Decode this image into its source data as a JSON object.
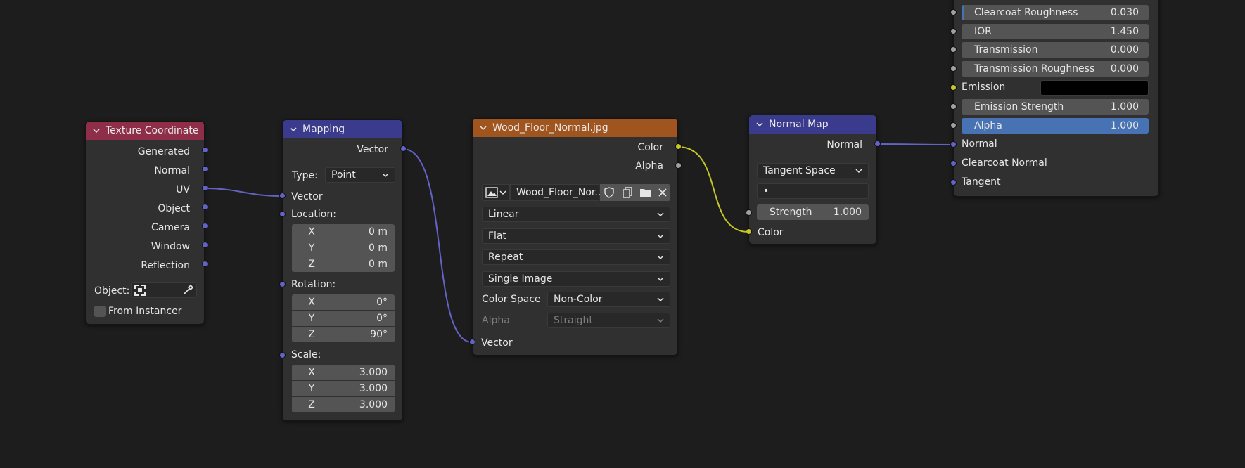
{
  "colors": {
    "background": "#1d1d1d",
    "node_body": "#303030",
    "header_texture_coordinate": "#8e2e48",
    "header_vector": "#3b3b8e",
    "header_image": "#a0541e",
    "socket_vector": "#6363c7",
    "socket_color": "#c7c729",
    "socket_float": "#a1a1a1",
    "wire_vector": "#6363c7",
    "wire_color": "#c7c729",
    "field_highlight": "#4772b3"
  },
  "texture_coordinate": {
    "title": "Texture Coordinate",
    "outputs": [
      "Generated",
      "Normal",
      "UV",
      "Object",
      "Camera",
      "Window",
      "Reflection"
    ],
    "object_label": "Object:",
    "from_instancer_label": "From Instancer"
  },
  "mapping": {
    "title": "Mapping",
    "output_vector": "Vector",
    "type_label": "Type:",
    "type_value": "Point",
    "input_vector": "Vector",
    "location_label": "Location:",
    "location": [
      {
        "axis": "X",
        "value": "0 m"
      },
      {
        "axis": "Y",
        "value": "0 m"
      },
      {
        "axis": "Z",
        "value": "0 m"
      }
    ],
    "rotation_label": "Rotation:",
    "rotation": [
      {
        "axis": "X",
        "value": "0°"
      },
      {
        "axis": "Y",
        "value": "0°"
      },
      {
        "axis": "Z",
        "value": "90°"
      }
    ],
    "scale_label": "Scale:",
    "scale": [
      {
        "axis": "X",
        "value": "3.000"
      },
      {
        "axis": "Y",
        "value": "3.000"
      },
      {
        "axis": "Z",
        "value": "3.000"
      }
    ]
  },
  "image_texture": {
    "title": "Wood_Floor_Normal.jpg",
    "output_color": "Color",
    "output_alpha": "Alpha",
    "image_name": "Wood_Floor_Nor...",
    "interpolation": "Linear",
    "projection": "Flat",
    "extension": "Repeat",
    "source": "Single Image",
    "color_space_label": "Color Space",
    "color_space_value": "Non-Color",
    "alpha_label": "Alpha",
    "alpha_value": "Straight",
    "input_vector": "Vector"
  },
  "normal_map": {
    "title": "Normal Map",
    "output_normal": "Normal",
    "space": "Tangent Space",
    "uv_map_value": "•",
    "strength_label": "Strength",
    "strength_value": "1.000",
    "input_color": "Color"
  },
  "principled_bsdf": {
    "fields": [
      {
        "label": "Clearcoat Roughness",
        "value": "0.030"
      },
      {
        "label": "IOR",
        "value": "1.450"
      },
      {
        "label": "Transmission",
        "value": "0.000"
      },
      {
        "label": "Transmission Roughness",
        "value": "0.000"
      }
    ],
    "emission_label": "Emission",
    "emission_strength": {
      "label": "Emission Strength",
      "value": "1.000"
    },
    "alpha": {
      "label": "Alpha",
      "value": "1.000"
    },
    "inputs": [
      "Normal",
      "Clearcoat Normal",
      "Tangent"
    ]
  }
}
